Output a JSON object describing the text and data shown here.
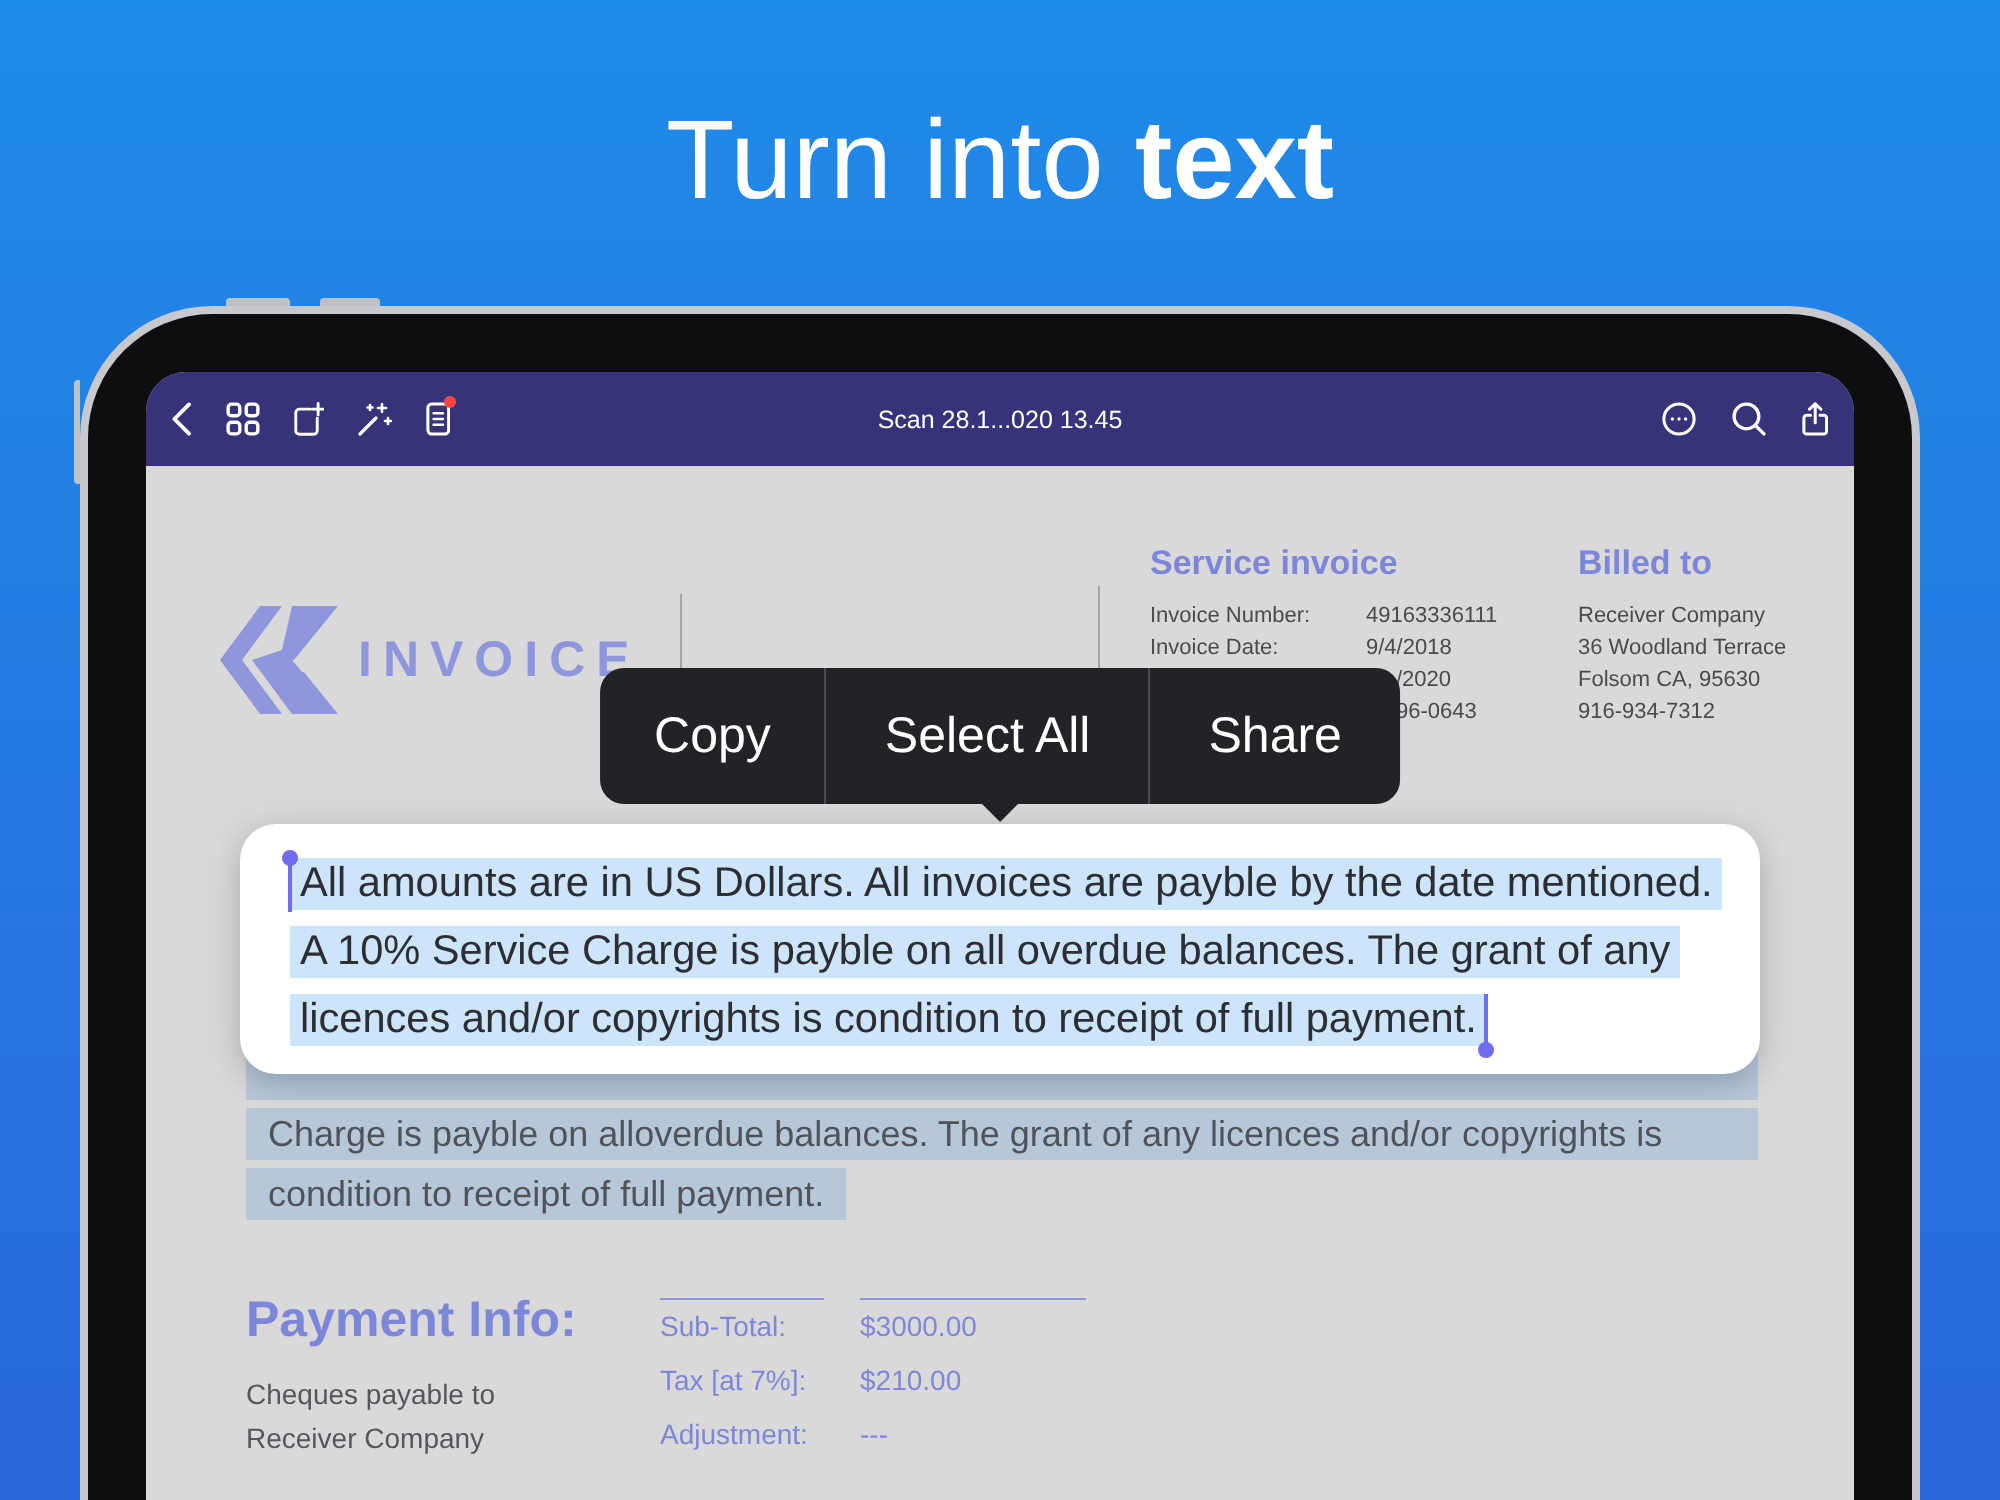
{
  "headline": "Turn into **text**",
  "toolbar": {
    "title": "Scan 28.1...020 13.45"
  },
  "document": {
    "logo_text": "INVOICE",
    "service_invoice": {
      "title": "Service invoice",
      "rows": [
        {
          "label": "Invoice Number:",
          "value": "49163336111"
        },
        {
          "label": "Invoice Date:",
          "value": "9/4/2018"
        },
        {
          "value": "/2020"
        },
        {
          "value": "96-0643"
        }
      ]
    },
    "billed_to": {
      "title": "Billed to",
      "lines": [
        "Receiver Company",
        "36 Woodland Terrace",
        "Folsom CA, 95630",
        "916-934-7312"
      ]
    },
    "selected_paragraph": {
      "selected": true,
      "lines": [
        "Charge is payble on alloverdue balances. The grant of any licences and/or copyrights is",
        "condition to receipt of full payment."
      ]
    },
    "payment_info": {
      "title": "Payment Info:",
      "note": "Cheques payable to Receiver Company",
      "totals": [
        {
          "label": "Sub-Total:",
          "value": "$3000.00"
        },
        {
          "label": "Tax [at 7%]:",
          "value": "$210.00"
        },
        {
          "label": "Adjustment:",
          "value": "---"
        }
      ]
    }
  },
  "context_menu": {
    "items": [
      "Copy",
      "Select All",
      "Share"
    ]
  },
  "magnifier": {
    "selected": true,
    "lines": [
      "All amounts are in US Dollars. All invoices are payble by the date mentioned.",
      "A 10% Service Charge is payble on all overdue balances. The grant of any",
      "licences and/or copyrights is condition to receipt of full payment."
    ]
  }
}
